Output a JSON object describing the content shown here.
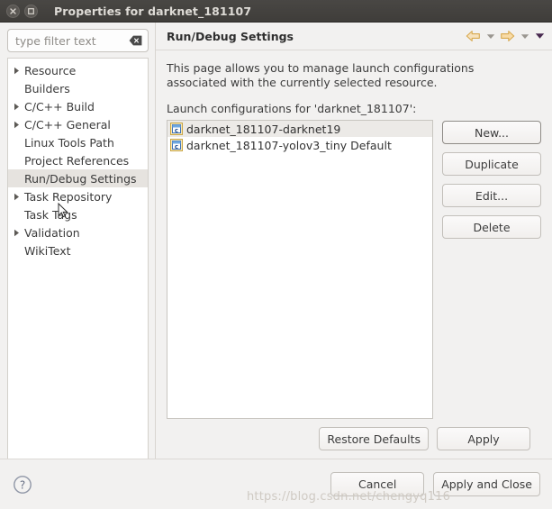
{
  "window": {
    "title": "Properties for darknet_181107",
    "close_icon": "close-icon",
    "minimize_icon": "minimize-icon"
  },
  "sidebar": {
    "filter": {
      "placeholder": "type filter text",
      "value": "",
      "clear_icon": "clear-icon"
    },
    "items": [
      {
        "label": "Resource",
        "expandable": true,
        "selected": false
      },
      {
        "label": "Builders",
        "expandable": false,
        "selected": false
      },
      {
        "label": "C/C++ Build",
        "expandable": true,
        "selected": false
      },
      {
        "label": "C/C++ General",
        "expandable": true,
        "selected": false
      },
      {
        "label": "Linux Tools Path",
        "expandable": false,
        "selected": false
      },
      {
        "label": "Project References",
        "expandable": false,
        "selected": false
      },
      {
        "label": "Run/Debug Settings",
        "expandable": false,
        "selected": true
      },
      {
        "label": "Task Repository",
        "expandable": true,
        "selected": false
      },
      {
        "label": "Task Tags",
        "expandable": false,
        "selected": false
      },
      {
        "label": "Validation",
        "expandable": true,
        "selected": false
      },
      {
        "label": "WikiText",
        "expandable": false,
        "selected": false
      }
    ]
  },
  "page": {
    "title": "Run/Debug Settings",
    "nav": {
      "back_icon": "arrow-left-icon",
      "back_menu_icon": "chevron-down-icon",
      "forward_icon": "arrow-right-icon",
      "forward_menu_icon": "chevron-down-icon",
      "view_menu_icon": "chevron-down-filled-icon"
    },
    "description_line1": "This page allows you to manage launch configurations",
    "description_line2": "associated with the currently selected resource.",
    "list_label": "Launch configurations for 'darknet_181107':",
    "configurations": [
      {
        "name": "darknet_181107-darknet19",
        "icon": "c-app-icon",
        "selected": true
      },
      {
        "name": "darknet_181107-yolov3_tiny Default",
        "icon": "c-app-icon",
        "selected": false
      }
    ],
    "list_buttons": [
      {
        "label": "New...",
        "default": true
      },
      {
        "label": "Duplicate",
        "default": false
      },
      {
        "label": "Edit...",
        "default": false
      },
      {
        "label": "Delete",
        "default": false
      }
    ],
    "footer_buttons": [
      {
        "label": "Restore Defaults"
      },
      {
        "label": "Apply"
      }
    ]
  },
  "dialog": {
    "help_icon": "help-icon",
    "buttons": [
      {
        "label": "Cancel"
      },
      {
        "label": "Apply and Close"
      }
    ]
  },
  "watermark": {
    "text": "https://blog.csdn.net/chengyq116"
  },
  "colors": {
    "titlebar": "#433f3c",
    "window_bg": "#f2f1f0",
    "selection": "#e6e3df",
    "accent_arrow": "#e0b870",
    "list_bg": "#ffffff"
  }
}
